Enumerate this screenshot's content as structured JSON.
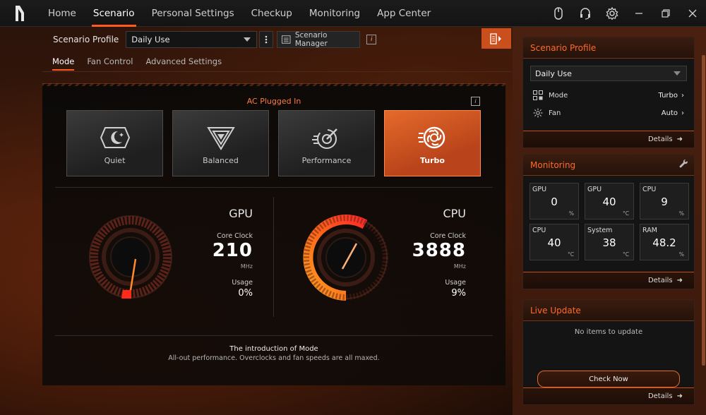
{
  "nav": {
    "items": [
      "Home",
      "Scenario",
      "Personal Settings",
      "Checkup",
      "Monitoring",
      "App Center"
    ],
    "active_index": 1
  },
  "profile_bar": {
    "label": "Scenario Profile",
    "selected": "Daily Use",
    "manager_label": "Scenario Manager"
  },
  "subtabs": {
    "items": [
      "Mode",
      "Fan Control",
      "Advanced Settings"
    ],
    "active_index": 0
  },
  "mode": {
    "power_state": "AC Plugged In",
    "options": [
      "Quiet",
      "Balanced",
      "Performance",
      "Turbo"
    ],
    "active_index": 3
  },
  "gpu": {
    "title": "GPU",
    "clock_label": "Core Clock",
    "clock_value": "210",
    "clock_unit": "MHz",
    "usage_label": "Usage",
    "usage_value": "0%",
    "usage_fraction": 0.0
  },
  "cpu": {
    "title": "CPU",
    "clock_label": "Core Clock",
    "clock_value": "3888",
    "clock_unit": "MHz",
    "usage_label": "Usage",
    "usage_value": "9%",
    "usage_fraction": 0.09
  },
  "intro": {
    "title": "The introduction of Mode",
    "description": "All-out performance. Overclocks and fan speeds are all maxed."
  },
  "side_profile": {
    "title": "Scenario Profile",
    "selected": "Daily Use",
    "mode_label": "Mode",
    "mode_value": "Turbo",
    "fan_label": "Fan",
    "fan_value": "Auto",
    "details": "Details"
  },
  "monitoring": {
    "title": "Monitoring",
    "cells": [
      {
        "label": "GPU",
        "value": "0",
        "unit": "%"
      },
      {
        "label": "GPU",
        "value": "40",
        "unit": "°C"
      },
      {
        "label": "CPU",
        "value": "9",
        "unit": "%"
      },
      {
        "label": "CPU",
        "value": "40",
        "unit": "°C"
      },
      {
        "label": "System",
        "value": "38",
        "unit": "°C"
      },
      {
        "label": "RAM",
        "value": "48.2",
        "unit": "%"
      }
    ],
    "details": "Details"
  },
  "live_update": {
    "title": "Live Update",
    "empty_text": "No items to update",
    "check_button": "Check Now",
    "details": "Details"
  },
  "colors": {
    "accent": "#ff5a1f",
    "active_mode": "#d85a23"
  }
}
